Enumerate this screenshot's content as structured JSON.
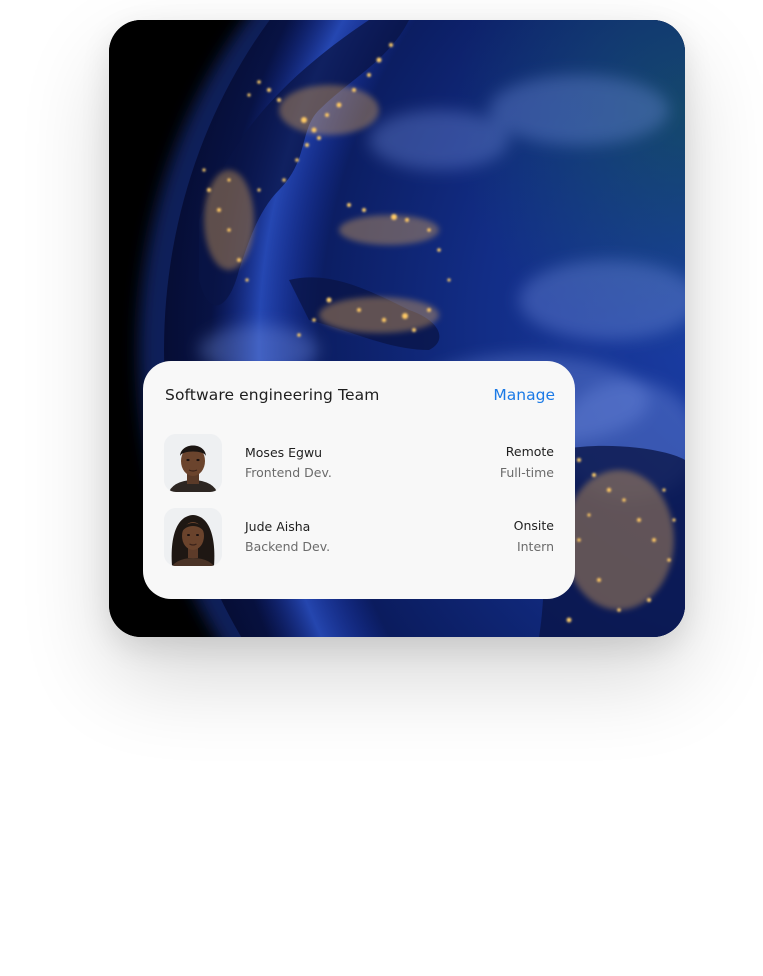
{
  "team_card": {
    "title": "Software engineering Team",
    "manage_label": "Manage",
    "accent_color": "#1b7ae6",
    "members": [
      {
        "name": "Moses Egwu",
        "role": "Frontend Dev.",
        "location": "Remote",
        "employment": "Full-time"
      },
      {
        "name": "Jude Aisha",
        "role": "Backend Dev.",
        "location": "Onsite",
        "employment": "Intern"
      }
    ]
  },
  "background_image": {
    "subject": "earth-at-night",
    "dominant_color": "#0b1f6e"
  }
}
